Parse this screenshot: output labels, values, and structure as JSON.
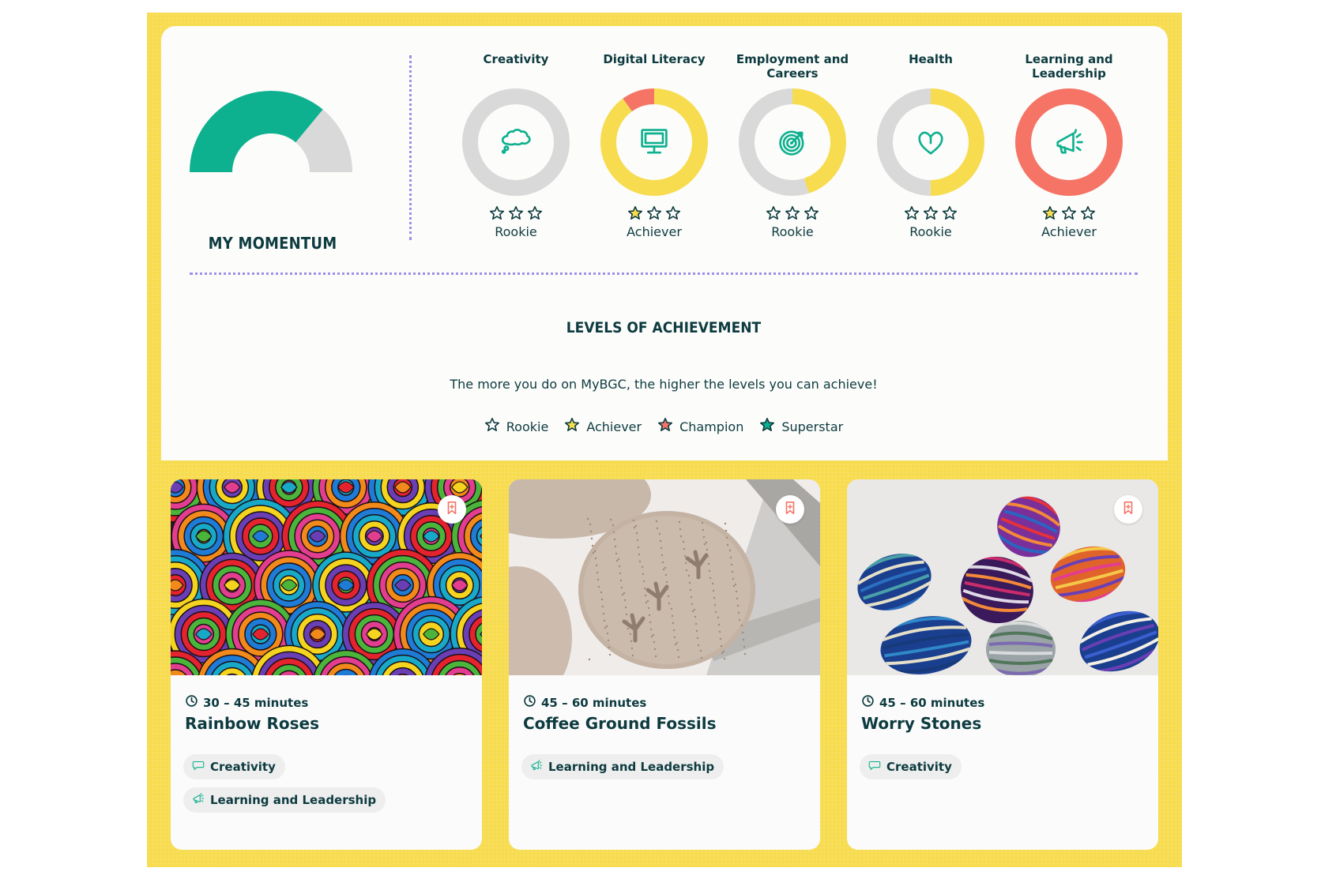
{
  "colors": {
    "frame_yellow": "#f7dc50",
    "teal": "#0db08f",
    "ring_grey": "#d9d9d9",
    "ring_yellow": "#f7dc50",
    "ring_coral": "#f57466",
    "dark_text": "#0d3b40",
    "divider_purple": "#9d8ee6"
  },
  "momentum": {
    "label": "MY MOMENTUM",
    "fill_fraction": 0.72
  },
  "categories": [
    {
      "title": "Creativity",
      "icon": "thought-bubble-icon",
      "level": "Rookie",
      "stars_filled": 0,
      "star_color": "",
      "progress_grey": 1.0,
      "progress_yellow": 0,
      "progress_coral": 0
    },
    {
      "title": "Digital Literacy",
      "icon": "monitor-icon",
      "level": "Achiever",
      "stars_filled": 1,
      "star_color": "#f7dc50",
      "progress_grey": 0,
      "progress_yellow": 0.9,
      "progress_coral": 0.1
    },
    {
      "title": "Employment and Careers",
      "icon": "target-icon",
      "level": "Rookie",
      "stars_filled": 0,
      "star_color": "",
      "progress_grey": 0.55,
      "progress_yellow": 0.45,
      "progress_coral": 0
    },
    {
      "title": "Health",
      "icon": "heart-icon",
      "level": "Rookie",
      "stars_filled": 0,
      "star_color": "",
      "progress_grey": 0.5,
      "progress_yellow": 0.5,
      "progress_coral": 0
    },
    {
      "title": "Learning and Leadership",
      "icon": "megaphone-icon",
      "level": "Achiever",
      "stars_filled": 1,
      "star_color": "#f7dc50",
      "progress_grey": 0,
      "progress_yellow": 0,
      "progress_coral": 1.0
    }
  ],
  "levels": {
    "title": "LEVELS OF ACHIEVEMENT",
    "description": "The more you do on MyBGC, the higher the levels you can achieve!",
    "legend": [
      {
        "label": "Rookie",
        "color": "none"
      },
      {
        "label": "Achiever",
        "color": "#f7dc50"
      },
      {
        "label": "Champion",
        "color": "#f57466"
      },
      {
        "label": "Superstar",
        "color": "#0db08f"
      }
    ]
  },
  "activities": [
    {
      "duration": "30 – 45 minutes",
      "title": "Rainbow Roses",
      "tags": [
        "Creativity",
        "Learning and Leadership"
      ],
      "image": "rainbow-roses-photo"
    },
    {
      "duration": "45 – 60 minutes",
      "title": "Coffee Ground Fossils",
      "tags": [
        "Learning and Leadership"
      ],
      "image": "coffee-fossils-photo"
    },
    {
      "duration": "45 – 60 minutes",
      "title": "Worry Stones",
      "tags": [
        "Creativity"
      ],
      "image": "worry-stones-photo"
    }
  ]
}
